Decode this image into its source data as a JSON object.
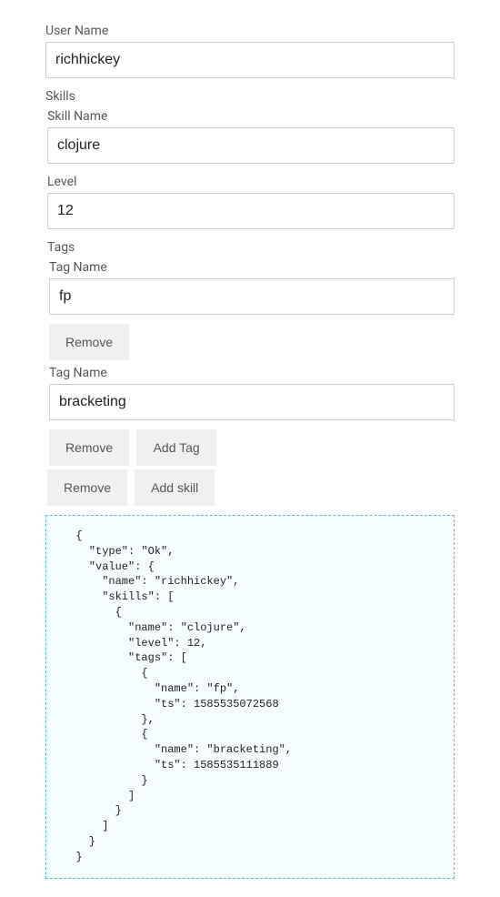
{
  "user": {
    "label": "User Name",
    "value": "richhickey"
  },
  "skillsSection": {
    "label": "Skills"
  },
  "skill": {
    "nameLabel": "Skill Name",
    "nameValue": "clojure",
    "levelLabel": "Level",
    "levelValue": "12"
  },
  "tagsSection": {
    "label": "Tags"
  },
  "tags": [
    {
      "label": "Tag Name",
      "value": "fp"
    },
    {
      "label": "Tag Name",
      "value": "bracketing"
    }
  ],
  "buttons": {
    "remove": "Remove",
    "addTag": "Add Tag",
    "addSkill": "Add skill"
  },
  "jsonOutput": "  {\n    \"type\": \"Ok\",\n    \"value\": {\n      \"name\": \"richhickey\",\n      \"skills\": [\n        {\n          \"name\": \"clojure\",\n          \"level\": 12,\n          \"tags\": [\n            {\n              \"name\": \"fp\",\n              \"ts\": 1585535072568\n            },\n            {\n              \"name\": \"bracketing\",\n              \"ts\": 1585535111889\n            }\n          ]\n        }\n      ]\n    }\n  }"
}
